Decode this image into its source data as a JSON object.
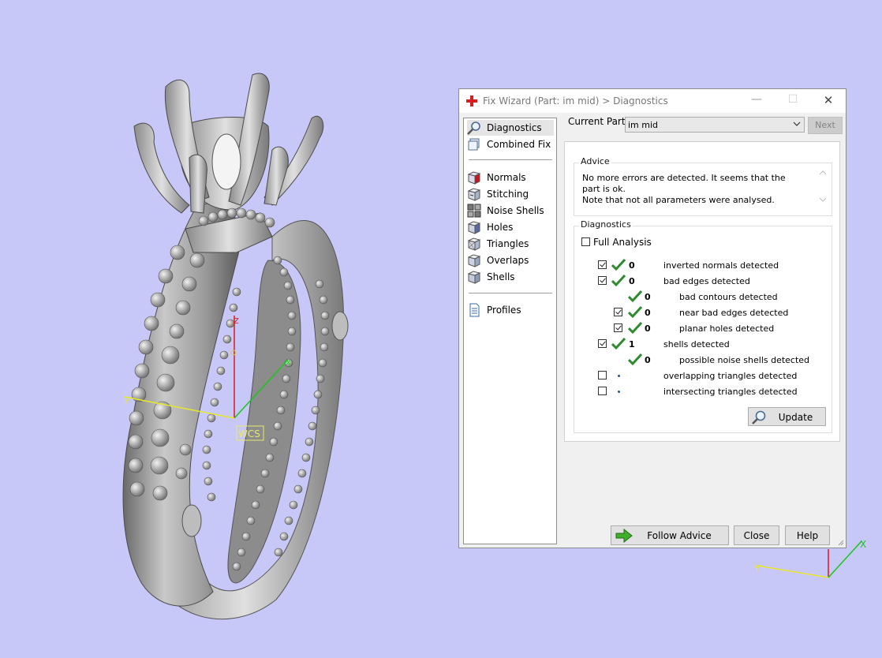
{
  "dialog": {
    "title": "Fix Wizard (Part: im mid) > Diagnostics",
    "controls": {
      "minimize": "—",
      "maximize": "☐",
      "close": "✕"
    }
  },
  "nav": {
    "top_items": [
      {
        "label": "Diagnostics",
        "icon": "magnifier-icon",
        "selected": true
      },
      {
        "label": "Combined Fix",
        "icon": "combined-fix-icon"
      }
    ],
    "fix_items": [
      {
        "label": "Normals",
        "icon": "normals-cube-icon"
      },
      {
        "label": "Stitching",
        "icon": "stitching-cube-icon"
      },
      {
        "label": "Noise Shells",
        "icon": "noise-shells-icon"
      },
      {
        "label": "Holes",
        "icon": "holes-cube-icon"
      },
      {
        "label": "Triangles",
        "icon": "triangles-cube-icon"
      },
      {
        "label": "Overlaps",
        "icon": "overlaps-cube-icon"
      },
      {
        "label": "Shells",
        "icon": "shells-cube-icon"
      }
    ],
    "bottom_items": [
      {
        "label": "Profiles",
        "icon": "profiles-document-icon"
      }
    ]
  },
  "current_part": {
    "label": "Current Part:",
    "value": "im mid"
  },
  "next_button": "Next",
  "advice": {
    "legend": "Advice",
    "line1": "No more errors are detected. It seems that the part is ok.",
    "line2": "Note that not all parameters were analysed."
  },
  "diagnostics": {
    "legend": "Diagnostics",
    "full_analysis": {
      "label": "Full Analysis",
      "checked": false
    },
    "rows": [
      {
        "checkbox": true,
        "checked": true,
        "status": "ok",
        "count": "0",
        "label": "inverted normals detected",
        "indent": 0
      },
      {
        "checkbox": true,
        "checked": true,
        "status": "ok",
        "count": "0",
        "label": "bad edges detected",
        "indent": 0
      },
      {
        "checkbox": false,
        "checked": false,
        "status": "ok",
        "count": "0",
        "label": "bad contours detected",
        "indent": 1
      },
      {
        "checkbox": true,
        "checked": true,
        "status": "ok",
        "count": "0",
        "label": "near bad edges detected",
        "indent": 1
      },
      {
        "checkbox": true,
        "checked": true,
        "status": "ok",
        "count": "0",
        "label": "planar holes detected",
        "indent": 1
      },
      {
        "checkbox": true,
        "checked": true,
        "status": "ok",
        "count": "1",
        "label": "shells detected",
        "indent": 0
      },
      {
        "checkbox": false,
        "checked": false,
        "status": "ok",
        "count": "0",
        "label": "possible noise shells detected",
        "indent": 1
      },
      {
        "checkbox": true,
        "checked": false,
        "status": "pending",
        "count": "",
        "label": "overlapping triangles detected",
        "indent": 0
      },
      {
        "checkbox": true,
        "checked": false,
        "status": "pending",
        "count": "",
        "label": "intersecting triangles detected",
        "indent": 0
      }
    ]
  },
  "buttons": {
    "update": "Update",
    "follow_advice": "Follow Advice",
    "close": "Close",
    "help": "Help"
  },
  "viewport": {
    "wcs_label": "WCS",
    "axis_labels": {
      "x": "X",
      "y": "Y",
      "z": "Z"
    },
    "mini_axis_labels": {
      "x": "X",
      "y": "Y"
    },
    "colors": {
      "background": "#c8c8f8",
      "x_axis": "#19c619",
      "y_axis": "#e8e82a",
      "z_axis": "#d81a1a",
      "accent_check": "#2e8b2e"
    }
  }
}
